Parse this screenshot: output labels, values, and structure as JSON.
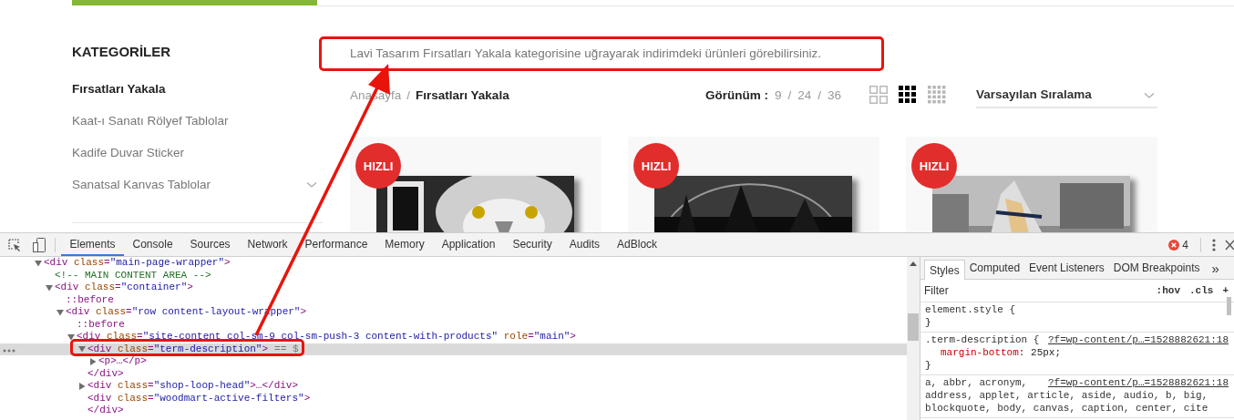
{
  "page": {
    "sidebar": {
      "title": "KATEGORİLER",
      "items": [
        {
          "label": "Fırsatları Yakala",
          "selected": true,
          "expandable": false
        },
        {
          "label": "Kaat-ı Sanatı Rölyef Tablolar",
          "selected": false,
          "expandable": false
        },
        {
          "label": "Kadife Duvar Sticker",
          "selected": false,
          "expandable": false
        },
        {
          "label": "Sanatsal Kanvas Tablolar",
          "selected": false,
          "expandable": true
        }
      ]
    },
    "description": "Lavi Tasarım Fırsatları Yakala kategorisine uğrayarak indirimdeki ürünleri görebilirsiniz.",
    "breadcrumb": [
      {
        "kind": "link",
        "text": "Anasayfa"
      },
      {
        "kind": "separator",
        "text": "/"
      },
      {
        "kind": "current",
        "text": "Fırsatları Yakala"
      }
    ],
    "per_page": {
      "label": "Görünüm :",
      "items": [
        {
          "kind": "option",
          "text": "9"
        },
        {
          "kind": "separator",
          "text": "/"
        },
        {
          "kind": "option",
          "text": "24"
        },
        {
          "kind": "separator",
          "text": "/"
        },
        {
          "kind": "option",
          "text": "36"
        }
      ]
    },
    "view_options": [
      {
        "kind": "large",
        "selected": false
      },
      {
        "kind": "medium",
        "selected": true
      },
      {
        "kind": "small",
        "selected": false
      }
    ],
    "sort": {
      "value": "Varsayılan Sıralama"
    },
    "products": [
      {
        "badge": "HIZLI",
        "kind": "picture"
      },
      {
        "badge": "HIZLI",
        "kind": "picture"
      },
      {
        "badge": "HIZLI",
        "kind": "picture"
      }
    ]
  },
  "devtools": {
    "tabs": [
      {
        "label": "Elements",
        "selected": true
      },
      {
        "label": "Console",
        "selected": false
      },
      {
        "label": "Sources",
        "selected": false
      },
      {
        "label": "Network",
        "selected": false
      },
      {
        "label": "Performance",
        "selected": false
      },
      {
        "label": "Memory",
        "selected": false
      },
      {
        "label": "Application",
        "selected": false
      },
      {
        "label": "Security",
        "selected": false
      },
      {
        "label": "Audits",
        "selected": false
      },
      {
        "label": "AdBlock",
        "selected": false
      }
    ],
    "error_count": "4",
    "dom_tree": [
      {
        "kind": "element",
        "text": "<div class=\"main-page-wrapper\">",
        "expanded": true,
        "children": [
          {
            "kind": "comment",
            "text": "<!-- MAIN CONTENT AREA -->"
          },
          {
            "kind": "element",
            "text": "<div class=\"container\">",
            "expanded": true,
            "children": [
              {
                "kind": "pseudo",
                "text": "::before"
              },
              {
                "kind": "element",
                "text": "<div class=\"row content-layout-wrapper\">",
                "expanded": true,
                "children": [
                  {
                    "kind": "pseudo",
                    "text": "::before"
                  },
                  {
                    "kind": "element",
                    "text": "<div class=\"site-content col-sm-9 col-sm-push-3 content-with-products\" role=\"main\">",
                    "expanded": true,
                    "children": [
                      {
                        "kind": "element",
                        "text": "<div class=\"term-description\">",
                        "suffix": "== $",
                        "selected": true,
                        "expanded": true,
                        "closing": "</div>",
                        "children": [
                          {
                            "kind": "element",
                            "text": "<p>…</p>",
                            "expanded": false
                          }
                        ]
                      },
                      {
                        "kind": "element",
                        "text": "<div class=\"shop-loop-head\">…</div>",
                        "expanded": false
                      },
                      {
                        "kind": "element",
                        "text": "<div class=\"woodmart-active-filters\">",
                        "closing": "</div>"
                      }
                    ]
                  }
                ]
              }
            ]
          }
        ]
      }
    ],
    "side_tabs": [
      {
        "label": "Styles",
        "selected": true
      },
      {
        "label": "Computed",
        "selected": false
      },
      {
        "label": "Event Listeners",
        "selected": false
      },
      {
        "label": "DOM Breakpoints",
        "selected": false
      }
    ],
    "more_tabs": "»",
    "filter": {
      "placeholder": "Filter",
      "buttons": [
        ":hov",
        ".cls",
        "+"
      ]
    },
    "rules": [
      {
        "selector": [
          "element.style {"
        ],
        "close": "}"
      },
      {
        "selector": [
          ".term-description {"
        ],
        "source": "?f=wp-content/p…=1528882621:18",
        "declarations": [
          {
            "property": "margin-bottom",
            "value": ": 25px;"
          }
        ],
        "close": "}"
      },
      {
        "selector": [
          "a, abbr, acronym,",
          "address, applet, article, aside, audio, b, big,",
          "blockquote, body, canvas, caption, center, cite"
        ],
        "source": "?f=wp-content/p…=1528882621:18"
      }
    ]
  },
  "annotations": {
    "description_box": true,
    "dom_box": true,
    "arrow": true
  }
}
